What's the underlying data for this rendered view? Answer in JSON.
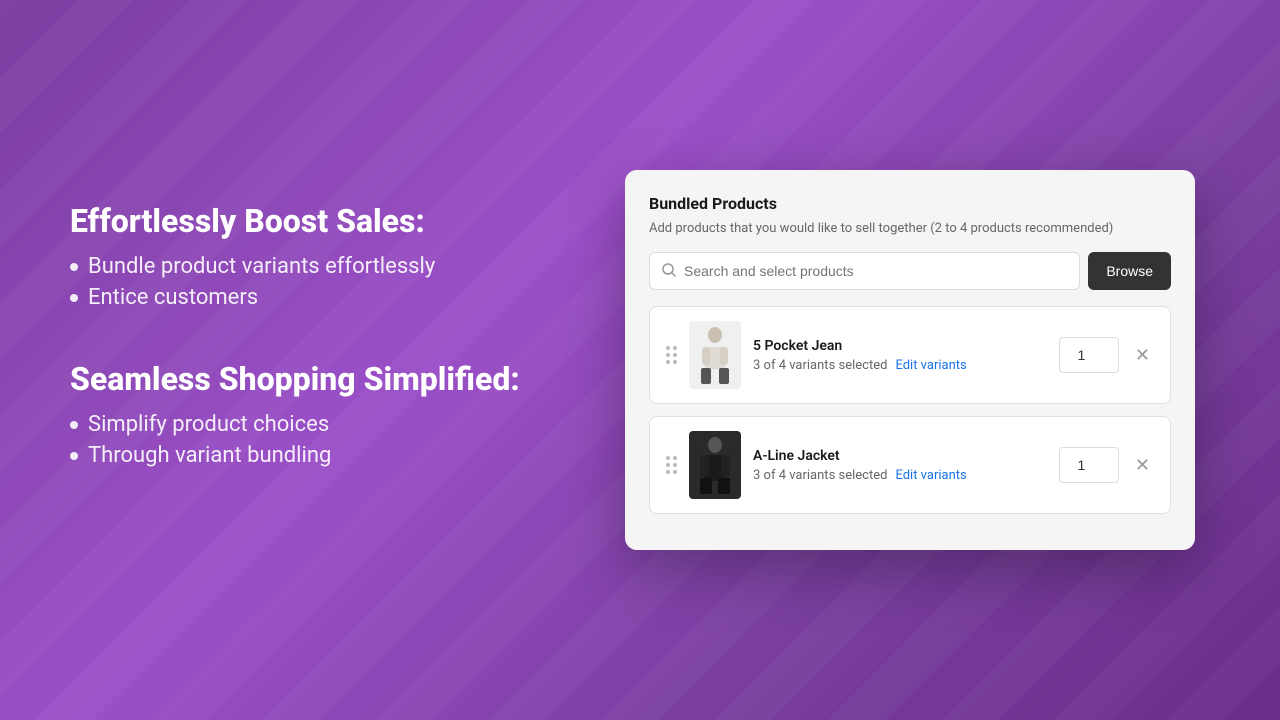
{
  "left": {
    "section1": {
      "title": "Effortlessly Boost Sales:",
      "bullets": [
        "Bundle product variants effortlessly",
        "Entice customers"
      ]
    },
    "section2": {
      "title": "Seamless Shopping Simplified:",
      "bullets": [
        "Simplify product choices",
        "Through variant bundling"
      ]
    }
  },
  "card": {
    "title": "Bundled Products",
    "subtitle": "Add products that you would like to sell together (2 to 4 products recommended)",
    "search": {
      "placeholder": "Search and select products"
    },
    "browse_label": "Browse",
    "products": [
      {
        "name": "5 Pocket Jean",
        "variants_text": "3 of 4 variants selected",
        "edit_label": "Edit variants",
        "quantity": "1",
        "image_type": "light"
      },
      {
        "name": "A-Line Jacket",
        "variants_text": "3 of 4 variants selected",
        "edit_label": "Edit variants",
        "quantity": "1",
        "image_type": "dark"
      }
    ]
  }
}
